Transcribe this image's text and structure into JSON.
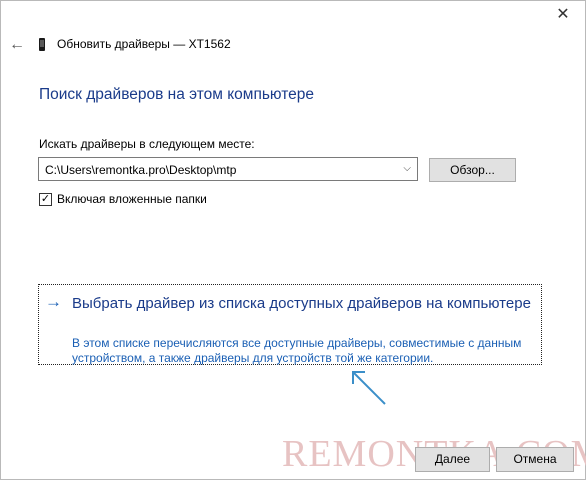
{
  "window": {
    "title": "Обновить драйверы — XT1562",
    "close_glyph": "✕",
    "back_glyph": "←"
  },
  "heading": "Поиск драйверов на этом компьютере",
  "path": {
    "label": "Искать драйверы в следующем месте:",
    "value": "C:\\Users\\remontka.pro\\Desktop\\mtp",
    "browse_label": "Обзор...",
    "dropdown_glyph": "⌵"
  },
  "include_subfolders": {
    "label": "Включая вложенные папки",
    "checked": true,
    "check_glyph": "✓"
  },
  "pick_option": {
    "arrow_glyph": "→",
    "title": "Выбрать драйвер из списка доступных драйверов на компьютере",
    "description": "В этом списке перечисляются все доступные драйверы, совместимые с данным устройством, а также драйверы для устройств той же категории."
  },
  "watermark": "REMONTKA.COM",
  "footer": {
    "next_label": "Далее",
    "cancel_label": "Отмена"
  },
  "colors": {
    "heading": "#1a3b8a",
    "link": "#1a5fb4",
    "annotation_arrow": "#3b8fc9"
  }
}
